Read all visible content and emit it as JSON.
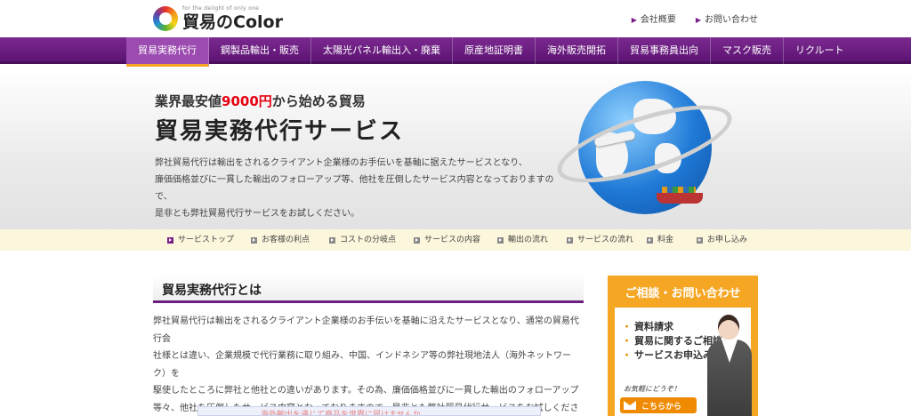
{
  "header": {
    "logo_tagline": "for the delight of only one",
    "logo_name": "貿易のColor",
    "links": [
      "会社概要",
      "お問い合わせ"
    ]
  },
  "nav": {
    "items": [
      "貿易実務代行",
      "鋼製品輸出・販売",
      "太陽光パネル輸出入・廃棄",
      "原産地証明書",
      "海外販売開拓",
      "貿易事務員出向",
      "マスク販売",
      "リクルート"
    ],
    "active_index": 0
  },
  "hero": {
    "lead_before": "業界最安値",
    "lead_price": "9000円",
    "lead_after": "から始める貿易",
    "title": "貿易実務代行サービス",
    "desc_lines": [
      "弊社貿易代行は輸出をされるクライアント企業様のお手伝いを基軸に据えたサービスとなり、",
      "廉価価格並びに一貫した輸出のフォローアップ等、他社を圧倒したサービス内容となっておりますので、",
      "是非とも弊社貿易代行サービスをお試しください。"
    ]
  },
  "subnav": {
    "items": [
      "サービストップ",
      "お客様の利点",
      "コストの分岐点",
      "サービスの内容",
      "輸出の流れ",
      "サービスの流れ",
      "料金",
      "お申し込み"
    ],
    "active_index": 0
  },
  "main": {
    "section_title": "貿易実務代行とは",
    "body_lines": [
      "弊社貿易代行は輸出をされるクライアント企業様のお手伝いを基軸に沿えたサービスとなり、通常の貿易代行会",
      "社様とは違い、企業規模で代行業務に取り組み、中国、インドネシア等の弊社現地法人（海外ネットワーク）を",
      "駆使したところに弊社と他社との違いがあります。その為、廉価価格並びに一貫した輸出のフォローアップ",
      "等々、他社を圧倒したサービス内容となっておりますので、是非とも弊社貿易代行サービスをお試しください。"
    ],
    "banner_text": "海外輸出を通じて商品を世界に届けませんか"
  },
  "sidebar": {
    "title": "ご相談・お問い合わせ",
    "items": [
      "資料請求",
      "貿易に関するご相談",
      "サービスお申込み"
    ],
    "note": "お気軽にどうぞ！",
    "button_label": "こちらから"
  },
  "colors": {
    "brand_purple": "#6b1f80",
    "accent_orange": "#f5a623",
    "price_red": "#e60012"
  }
}
